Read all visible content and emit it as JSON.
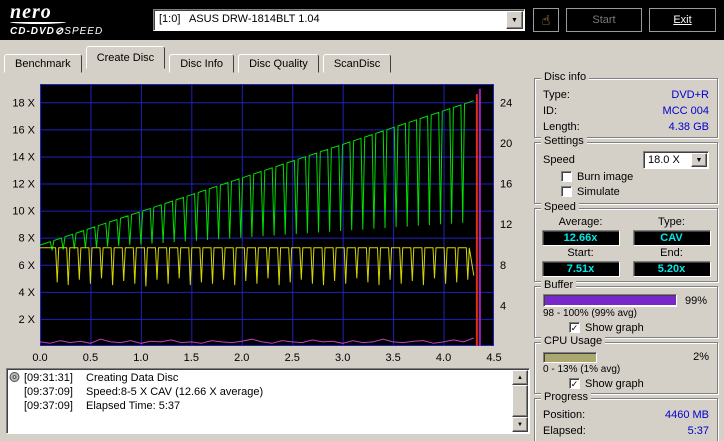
{
  "titlebar": {
    "logo_line1": "nero",
    "logo_line2a": "CD-DVD",
    "logo_disc_glyph": "⊘",
    "logo_line2b": "SPEED",
    "drive_select": "[1:0]   ASUS DRW-1814BLT 1.04",
    "hand_icon": "☝",
    "start_label": "Start",
    "exit_label": "Exit",
    "combo_arrow": "▼"
  },
  "tabs": [
    {
      "label": "Benchmark",
      "active": false
    },
    {
      "label": "Create Disc",
      "active": true
    },
    {
      "label": "Disc Info",
      "active": false
    },
    {
      "label": "Disc Quality",
      "active": false
    },
    {
      "label": "ScanDisc",
      "active": false
    }
  ],
  "chart_data": {
    "type": "line",
    "xlim": [
      0,
      4.5
    ],
    "ylim": [
      0,
      19.35
    ],
    "x_ticks": [
      0.0,
      0.5,
      1.0,
      1.5,
      2.0,
      2.5,
      3.0,
      3.5,
      4.0,
      4.5
    ],
    "left_axis_ticks": [
      2,
      4,
      6,
      8,
      10,
      12,
      14,
      16,
      18
    ],
    "left_axis_suffix": " X",
    "right_axis_ticks": [
      4,
      8,
      12,
      16,
      20,
      24
    ],
    "right_axis_scale": 0.75,
    "colors": {
      "bg": "#000000",
      "grid": "#2121bd",
      "green": "#00dd00",
      "yellow": "#d6d600",
      "magenta": "#c040c0",
      "red": "#e03010",
      "end_purple": "#a020c0"
    },
    "green_series": {
      "name": "write-speed",
      "start": [
        0,
        7.45
      ],
      "slope": 2.48,
      "end_x": 4.3,
      "dip_half_width": 0.018,
      "dips": [
        [
          0.12,
          7.06
        ],
        [
          0.23,
          7.12
        ],
        [
          0.34,
          7.17
        ],
        [
          0.45,
          7.23
        ],
        [
          0.56,
          7.28
        ],
        [
          0.67,
          7.34
        ],
        [
          0.78,
          7.39
        ],
        [
          0.89,
          7.45
        ],
        [
          1.0,
          7.5
        ],
        [
          1.11,
          7.56
        ],
        [
          1.22,
          7.61
        ],
        [
          1.33,
          7.67
        ],
        [
          1.44,
          7.72
        ],
        [
          1.55,
          7.78
        ],
        [
          1.66,
          7.83
        ],
        [
          1.77,
          7.89
        ],
        [
          1.88,
          7.94
        ],
        [
          1.99,
          8.0
        ],
        [
          2.1,
          8.05
        ],
        [
          2.21,
          8.11
        ],
        [
          2.32,
          8.16
        ],
        [
          2.43,
          8.22
        ],
        [
          2.54,
          8.27
        ],
        [
          2.65,
          8.33
        ],
        [
          2.76,
          8.38
        ],
        [
          2.87,
          8.44
        ],
        [
          2.98,
          8.49
        ],
        [
          3.09,
          8.55
        ],
        [
          3.2,
          8.6
        ],
        [
          3.31,
          8.66
        ],
        [
          3.42,
          8.71
        ],
        [
          3.53,
          8.77
        ],
        [
          3.64,
          8.82
        ],
        [
          3.75,
          8.88
        ],
        [
          3.86,
          8.93
        ],
        [
          3.97,
          8.99
        ],
        [
          4.08,
          9.04
        ],
        [
          4.19,
          9.1
        ]
      ]
    },
    "yellow_series": {
      "name": "rotation-speed",
      "base": 7.25,
      "end": [
        4.3,
        5.2
      ],
      "dip_half_width": 0.015,
      "dips": [
        [
          0.17,
          4.7
        ],
        [
          0.28,
          4.5
        ],
        [
          0.39,
          4.9
        ],
        [
          0.5,
          4.6
        ],
        [
          0.61,
          5.0
        ],
        [
          0.72,
          4.5
        ],
        [
          0.83,
          4.8
        ],
        [
          0.94,
          4.6
        ],
        [
          1.05,
          4.4
        ],
        [
          1.16,
          4.9
        ],
        [
          1.27,
          4.6
        ],
        [
          1.38,
          5.0
        ],
        [
          1.49,
          4.5
        ],
        [
          1.6,
          4.7
        ],
        [
          1.71,
          4.6
        ],
        [
          1.82,
          4.9
        ],
        [
          1.93,
          4.5
        ],
        [
          2.04,
          4.8
        ],
        [
          2.15,
          4.6
        ],
        [
          2.26,
          5.0
        ],
        [
          2.37,
          4.5
        ],
        [
          2.48,
          4.7
        ],
        [
          2.59,
          4.9
        ],
        [
          2.7,
          4.6
        ],
        [
          2.81,
          4.5
        ],
        [
          2.92,
          4.8
        ],
        [
          3.03,
          4.6
        ],
        [
          3.14,
          5.0
        ],
        [
          3.25,
          4.7
        ],
        [
          3.36,
          4.5
        ],
        [
          3.47,
          4.9
        ],
        [
          3.58,
          4.6
        ],
        [
          3.69,
          4.8
        ],
        [
          3.8,
          4.5
        ],
        [
          3.91,
          5.0
        ],
        [
          4.02,
          4.6
        ],
        [
          4.13,
          4.7
        ],
        [
          4.24,
          4.9
        ]
      ]
    },
    "magenta_series": {
      "name": "cpu-usage",
      "x_step": 0.1,
      "values": [
        0.3,
        0.2,
        0.4,
        0.25,
        0.35,
        0.2,
        0.5,
        0.3,
        0.25,
        0.4,
        0.2,
        0.35,
        0.3,
        0.45,
        0.25,
        0.3,
        0.2,
        0.4,
        0.3,
        0.25,
        0.35,
        0.5,
        0.3,
        0.2,
        0.4,
        0.3,
        0.25,
        0.45,
        0.3,
        0.35,
        0.2,
        0.4,
        0.25,
        0.3,
        0.5,
        0.3,
        0.25,
        0.35,
        0.4,
        0.2,
        0.3,
        0.45,
        0.3,
        0.6
      ]
    },
    "end_markers": [
      {
        "name": "end-line-red",
        "color": "#e03010",
        "x": 4.33,
        "y0": 0,
        "y1": 18.6
      },
      {
        "name": "end-line-purple",
        "color": "#a020c0",
        "x": 4.36,
        "y0": 0,
        "y1": 19.0
      }
    ]
  },
  "disc_info": {
    "title": "Disc info",
    "rows": [
      {
        "label": "Type:",
        "value": "DVD+R"
      },
      {
        "label": "ID:",
        "value": "MCC 004"
      },
      {
        "label": "Length:",
        "value": "4.38 GB"
      }
    ]
  },
  "settings": {
    "title": "Settings",
    "speed_label": "Speed",
    "speed_value": "18.0 X",
    "combo_arrow": "▼",
    "checkboxes": [
      {
        "label": "Burn image",
        "glyph": ""
      },
      {
        "label": "Simulate",
        "glyph": ""
      }
    ]
  },
  "speed": {
    "title": "Speed",
    "average_label": "Average:",
    "average_value": "12.66x",
    "type_label": "Type:",
    "type_value": "CAV",
    "start_label": "Start:",
    "start_value": "7.51x",
    "end_label": "End:",
    "end_value": "5.20x"
  },
  "buffer": {
    "title": "Buffer",
    "percent": 99,
    "percent_label": "99%",
    "bar_color": "#7828c8",
    "range_label": "98 - 100% (99% avg)",
    "show_graph_label": "Show graph",
    "check_glyph": "✓"
  },
  "cpu": {
    "title": "CPU Usage",
    "percent_label": "2%",
    "swatch_color": "#aaa86e",
    "range_label": "0 - 13% (1% avg)",
    "show_graph_label": "Show graph",
    "check_glyph": "✓"
  },
  "progress": {
    "title": "Progress",
    "position_label": "Position:",
    "position_value": "4460 MB",
    "elapsed_label": "Elapsed:",
    "elapsed_value": "5:37"
  },
  "log": {
    "rows": [
      {
        "time": "[09:31:31]",
        "text": "Creating Data Disc"
      },
      {
        "time": "[09:37:09]",
        "text": "Speed:8-5 X CAV (12.66 X average)"
      },
      {
        "time": "[09:37:09]",
        "text": "Elapsed Time: 5:37"
      }
    ]
  },
  "scrollbar": {
    "up": "▲",
    "down": "▼"
  }
}
